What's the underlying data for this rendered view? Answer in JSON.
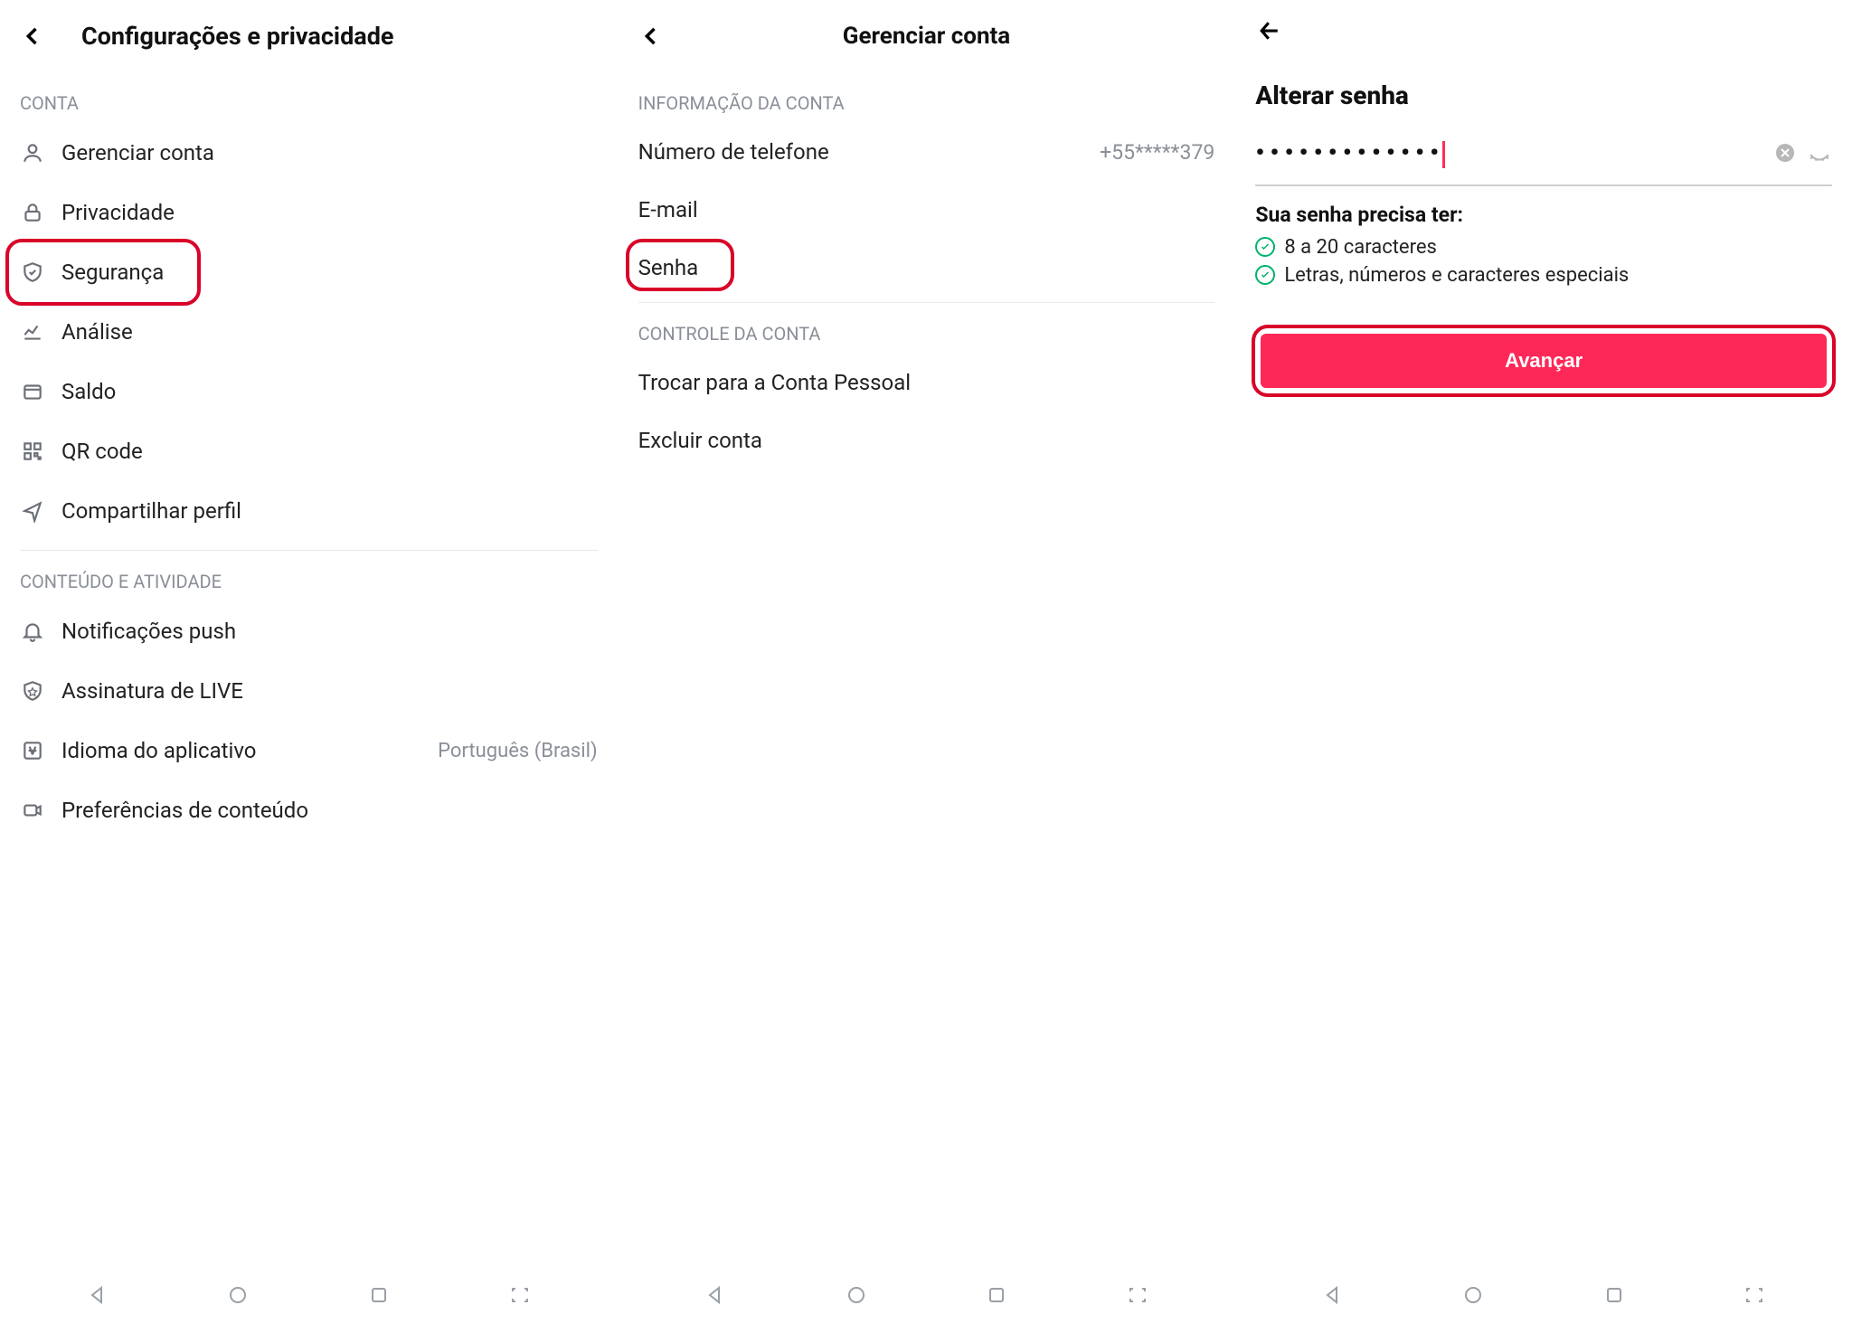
{
  "panel1": {
    "title": "Configurações e privacidade",
    "section_conta": "CONTA",
    "items_conta": [
      {
        "icon": "person",
        "label": "Gerenciar conta"
      },
      {
        "icon": "lock",
        "label": "Privacidade"
      },
      {
        "icon": "shield",
        "label": "Segurança"
      },
      {
        "icon": "analytics",
        "label": "Análise"
      },
      {
        "icon": "wallet",
        "label": "Saldo"
      },
      {
        "icon": "qr",
        "label": "QR code"
      },
      {
        "icon": "share",
        "label": "Compartilhar perfil"
      }
    ],
    "section_conteudo": "CONTEÚDO E ATIVIDADE",
    "items_conteudo": [
      {
        "icon": "bell",
        "label": "Notificações push"
      },
      {
        "icon": "live-shield",
        "label": "Assinatura de LIVE"
      },
      {
        "icon": "language",
        "label": "Idioma do aplicativo",
        "trailing": "Português (Brasil)"
      },
      {
        "icon": "camera",
        "label": "Preferências de conteúdo"
      }
    ]
  },
  "panel2": {
    "title": "Gerenciar conta",
    "section_info": "INFORMAÇÃO DA CONTA",
    "rows": [
      {
        "label": "Número de telefone",
        "value": "+55*****379"
      },
      {
        "label": "E-mail"
      },
      {
        "label": "Senha"
      }
    ],
    "section_control": "CONTROLE DA CONTA",
    "control_rows": [
      {
        "label": "Trocar para a Conta Pessoal"
      },
      {
        "label": "Excluir conta"
      }
    ]
  },
  "panel3": {
    "title": "Alterar senha",
    "password_mask": "•••••••••••••",
    "rules_title": "Sua senha precisa ter:",
    "rules": [
      "8 a 20 caracteres",
      "Letras, números e caracteres especiais"
    ],
    "advance_label": "Avançar"
  }
}
